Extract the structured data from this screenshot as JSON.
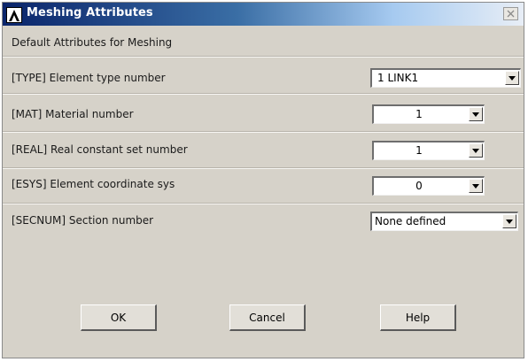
{
  "window": {
    "title": "Meshing Attributes",
    "subtitle": "Default Attributes for Meshing"
  },
  "fields": [
    {
      "label": "[TYPE]  Element type number",
      "value": "1    LINK1"
    },
    {
      "label": "[MAT]  Material number",
      "value": "1"
    },
    {
      "label": "[REAL]  Real constant set number",
      "value": "1"
    },
    {
      "label": "[ESYS]  Element coordinate sys",
      "value": "0"
    },
    {
      "label": "[SECNUM]  Section number",
      "value": "None defined"
    }
  ],
  "buttons": {
    "ok": "OK",
    "cancel": "Cancel",
    "help": "Help"
  },
  "icons": {
    "app": "ansys-logo-icon",
    "close": "close-icon",
    "dropdown": "chevron-down-icon"
  },
  "colors": {
    "titlebar_start": "#0a246a",
    "titlebar_end": "#a6caf0",
    "dialog_bg": "#d6d2c9"
  }
}
